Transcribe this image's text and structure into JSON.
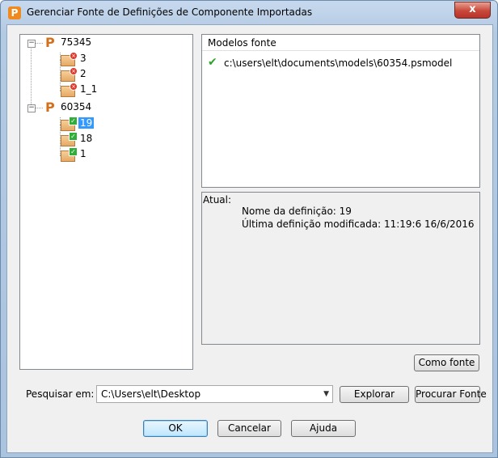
{
  "window": {
    "title": "Gerenciar Fonte de Definições de Componente Importadas",
    "app_icon_letter": "P",
    "close_glyph": "x"
  },
  "tree": {
    "groups": [
      {
        "label": "75345",
        "expander": "−",
        "children": [
          {
            "label": "3",
            "status": "error"
          },
          {
            "label": "2",
            "status": "error"
          },
          {
            "label": "1_1",
            "status": "error"
          }
        ]
      },
      {
        "label": "60354",
        "expander": "−",
        "children": [
          {
            "label": "19",
            "status": "ok",
            "selected": true
          },
          {
            "label": "18",
            "status": "ok"
          },
          {
            "label": "1",
            "status": "ok"
          }
        ]
      }
    ]
  },
  "models": {
    "header": "Modelos fonte",
    "check_glyph": "✔",
    "path": "c:\\users\\elt\\documents\\models\\60354.psmodel"
  },
  "info": {
    "label": "Atual:",
    "definition_name": "Nome da definição: 19",
    "last_modified": "Última definição modificada: 11:19:6 16/6/2016"
  },
  "buttons": {
    "como_fonte": "Como fonte",
    "explorar": "Explorar",
    "procurar_fonte": "Procurar Fonte",
    "ok": "OK",
    "cancelar": "Cancelar",
    "ajuda": "Ajuda"
  },
  "search": {
    "label": "Pesquisar em:",
    "value": "C:\\Users\\elt\\Desktop",
    "arrow": "▼"
  },
  "colors": {
    "selection": "#3399ff",
    "error_badge": "#e0362b",
    "ok_badge": "#2fae3a",
    "pm_icon": "#d4701c"
  }
}
